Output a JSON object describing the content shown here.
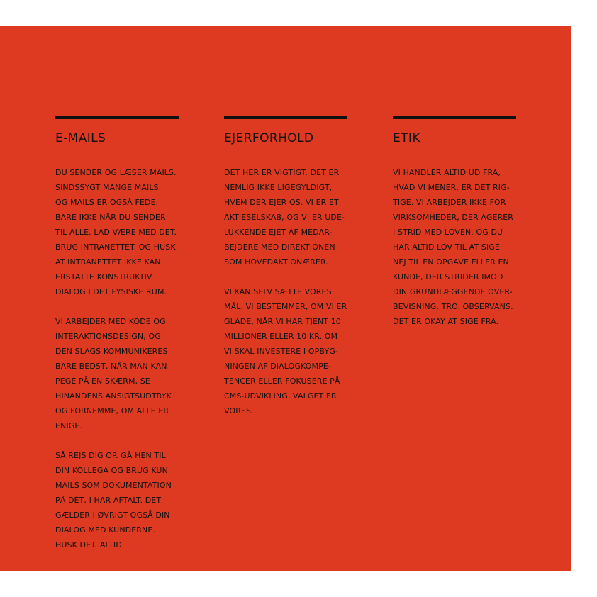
{
  "colors": {
    "panel": "#dd3a21",
    "text": "#111111",
    "rule": "#111111"
  },
  "columns": [
    {
      "heading": "E-MAILS",
      "paragraphs": [
        [
          "DU SENDER OG LÆSER MAILS.",
          "SINDSSYGT MANGE MAILS.",
          "OG MAILS ER OGSÅ FEDE.",
          "BARE IKKE NÅR DU SENDER",
          "TIL ALLE. LAD VÆRE MED DET.",
          "BRUG INTRANETTET. OG HUSK",
          "AT INTRANETTET IKKE KAN",
          "ERSTATTE KONSTRUKTIV",
          "DIALOG I DET FYSISKE RUM."
        ],
        [
          "VI ARBEJDER MED KODE OG",
          "INTERAKTIONSDESIGN, OG",
          "DEN SLAGS KOMMUNIKERES",
          "BARE BEDST, NÅR MAN KAN",
          "PEGE PÅ EN SKÆRM, SE",
          "HINANDENS ANSIGTSUDTRYK",
          "OG FORNEMME, OM ALLE ER",
          "ENIGE."
        ],
        [
          "SÅ REJS DIG OP. GÅ HEN TIL",
          "DIN KOLLEGA OG BRUG KUN",
          "MAILS SOM DOKUMENTATION",
          "PÅ DÉT, I HAR AFTALT. DET",
          "GÆLDER I ØVRIGT OGSÅ DIN",
          "DIALOG MED KUNDERNE.",
          "HUSK DET. ALTID."
        ]
      ]
    },
    {
      "heading": "EJERFORHOLD",
      "paragraphs": [
        [
          "DET HER ER VIGTIGT. DET ER",
          "NEMLIG IKKE LIGEGYLDIGT,",
          "HVEM DER EJER OS. VI ER ET",
          "AKTIESELSKAB, OG VI ER UDE-",
          "LUKKENDE EJET AF MEDAR-",
          "BEJDERE MED DIREKTIONEN",
          "SOM HOVEDAKTIONÆRER."
        ],
        [
          "VI KAN SELV SÆTTE VORES",
          "MÅL. VI BESTEMMER, OM VI ER",
          "GLADE, NÅR VI HAR TJENT 10",
          "MILLIONER ELLER 10 KR. OM",
          "VI SKAL INVESTERE I OPBYG-",
          "NINGEN AF DIALOGKOMPE-",
          "TENCER ELLER FOKUSERE PÅ",
          "CMS-UDVIKLING. VALGET ER",
          "VORES."
        ]
      ]
    },
    {
      "heading": "ETIK",
      "paragraphs": [
        [
          "VI HANDLER ALTID UD FRA,",
          "HVAD VI MENER, ER DET RIG-",
          "TIGE. VI ARBEJDER IKKE FOR",
          "VIRKSOMHEDER, DER AGERER",
          "I STRID MED LOVEN. OG DU",
          "HAR ALTID LOV TIL AT SIGE",
          "NEJ TIL EN OPGAVE ELLER EN",
          "KUNDE, DER STRIDER IMOD",
          "DIN GRUNDLÆGGENDE OVER-",
          "BEVISNING. TRO. OBSERVANS.",
          "DET ER OKAY AT SIGE FRA."
        ]
      ]
    }
  ]
}
